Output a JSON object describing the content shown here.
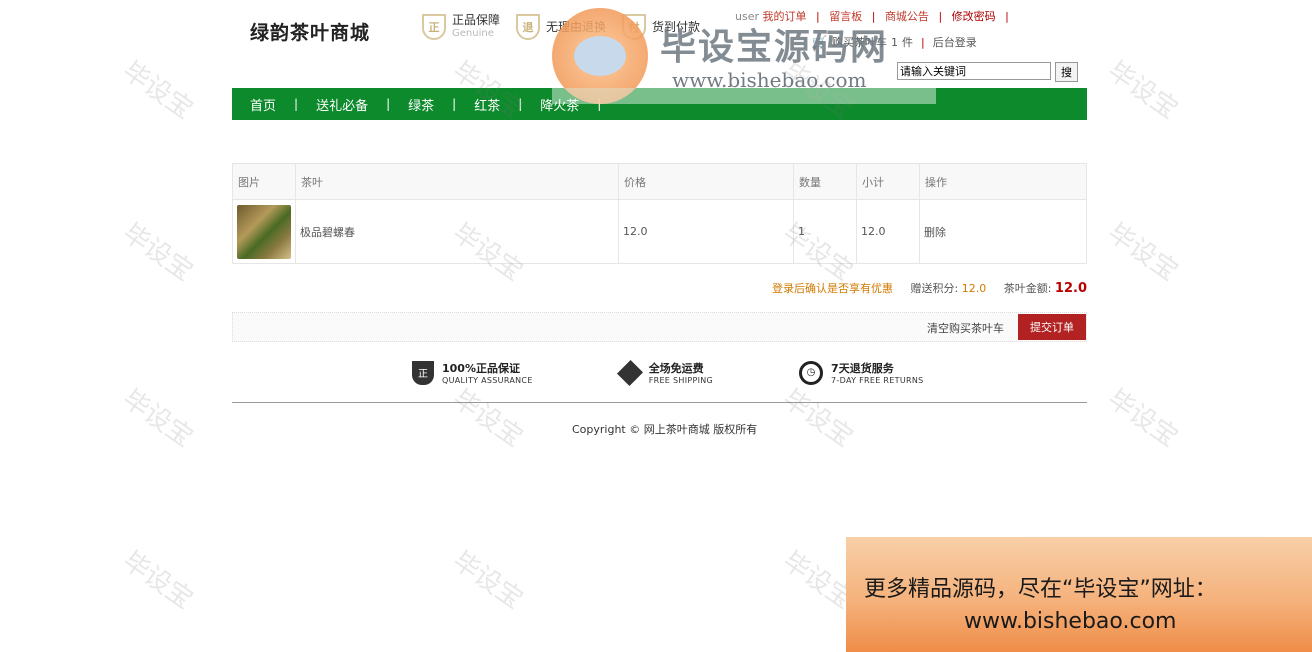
{
  "site": {
    "logo": "绿韵茶叶商城"
  },
  "badges": [
    {
      "icon": "shield-icon",
      "glyph": "正",
      "title": "正品保障",
      "sub": "Genuine"
    },
    {
      "icon": "refund-icon",
      "glyph": "退",
      "title": "无理由退换",
      "sub": ""
    },
    {
      "icon": "pay-icon",
      "glyph": "付",
      "title": "货到付款",
      "sub": ""
    }
  ],
  "toplinks": {
    "user": "user",
    "orders": "我的订单",
    "guestbook": "留言板",
    "notice": "商城公告",
    "password": "修改密码"
  },
  "cartbar": {
    "cart": "购买茶叶车",
    "cart_count": "1",
    "unit": "件",
    "admin": "后台登录"
  },
  "search": {
    "placeholder": "请输入关键词",
    "value": "请输入关键词",
    "button": "搜"
  },
  "nav": {
    "items": [
      "首页",
      "送礼必备",
      "绿茶",
      "红茶",
      "降火茶"
    ]
  },
  "cart": {
    "headers": [
      "图片",
      "茶叶",
      "价格",
      "数量",
      "小计",
      "操作"
    ],
    "rows": [
      {
        "name": "极品碧螺春",
        "price": "12.0",
        "qty": "1",
        "subtotal": "12.0",
        "action": "删除"
      }
    ],
    "login_tip": "登录后确认是否享有优惠",
    "points_label": "赠送积分:",
    "points": "12.0",
    "total_label": "茶叶金额:",
    "total": "12.0",
    "clear": "清空购买茶叶车",
    "submit": "提交订单"
  },
  "guarantees": [
    {
      "icon": "shield-icon",
      "glyph": "正",
      "title": "100%正品保证",
      "sub": "QUALITY ASSURANCE"
    },
    {
      "icon": "box-icon",
      "glyph": "",
      "title": "全场免运费",
      "sub": "FREE SHIPPING"
    },
    {
      "icon": "clock-icon",
      "glyph": "",
      "title": "7天退货服务",
      "sub": "7-DAY FREE RETURNS"
    }
  ],
  "footer": {
    "copyright": "Copyright © 网上茶叶商城 版权所有"
  },
  "watermark": {
    "text": "毕设宝",
    "big_title": "毕设宝源码网",
    "big_domain": "www.bishebao.com",
    "promo_line1": "更多精品源码，尽在“毕设宝”网址：",
    "promo_line2": "www.bishebao.com"
  },
  "colors": {
    "nav_green": "#0c8a2c",
    "submit_red": "#b22222",
    "accent_orange": "#d07a00"
  }
}
